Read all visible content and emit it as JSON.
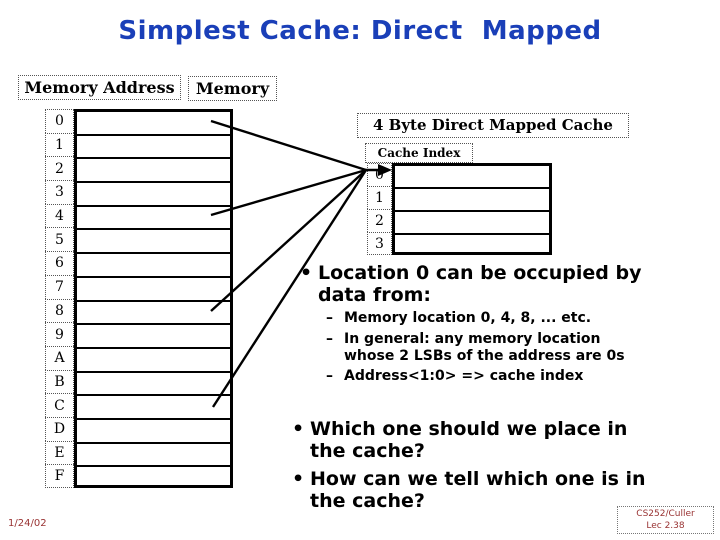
{
  "slide": {
    "title": "Simplest Cache: Direct  Mapped",
    "title_color": "#1a3fb8"
  },
  "memory_table": {
    "address_header": "Memory Address",
    "data_header": "Memory",
    "addresses": [
      "0",
      "1",
      "2",
      "3",
      "4",
      "5",
      "6",
      "7",
      "8",
      "9",
      "A",
      "B",
      "C",
      "D",
      "E",
      "F"
    ]
  },
  "cache_table": {
    "header": "4  Byte Direct Mapped Cache",
    "index_header": "Cache Index",
    "indices": [
      "0",
      "1",
      "2",
      "3"
    ]
  },
  "mapping_arrows": {
    "from_addresses": [
      "0",
      "4",
      "8",
      "C"
    ],
    "to_index": "0"
  },
  "bullets": [
    {
      "text": "Location 0 can be occupied by\ndata from:",
      "marker": "•",
      "sub": [
        {
          "marker": "–",
          "text": "Memory location 0, 4, 8, ... etc."
        },
        {
          "marker": "–",
          "text": "In general: any memory location\nwhose 2 LSBs of the address are 0s"
        },
        {
          "marker": "–",
          "text": "Address<1:0>  => cache index"
        }
      ]
    }
  ],
  "bullets_lower": [
    {
      "marker": "•",
      "text": "Which one should we place in\nthe cache?"
    },
    {
      "marker": "•",
      "text": "How can we tell which one is in\nthe cache?"
    }
  ],
  "footer": {
    "date": "1/24/02",
    "course": "CS252/Culler",
    "lecture": "Lec 2.38",
    "color": "#993333"
  }
}
